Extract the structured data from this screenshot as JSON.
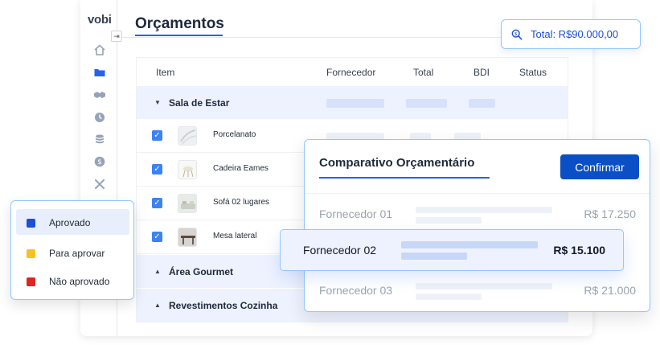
{
  "app": {
    "logo": "vobi"
  },
  "sidebar": {
    "icons": [
      "home-icon",
      "folder-icon",
      "handshake-icon",
      "clock-icon",
      "coins-icon",
      "dollar-icon",
      "tools-icon"
    ]
  },
  "header": {
    "title": "Orçamentos"
  },
  "total": {
    "label": "Total: R$90.000,00",
    "icon": "search-dollar-icon"
  },
  "table": {
    "columns": {
      "item": "Item",
      "supplier": "Fornecedor",
      "total": "Total",
      "bdi": "BDI",
      "status": "Status"
    },
    "groups": [
      {
        "label": "Sala de Estar",
        "expanded": true
      },
      {
        "label": "Área Gourmet",
        "expanded": false
      },
      {
        "label": "Revestimentos Cozinha",
        "expanded": false
      }
    ],
    "items": [
      {
        "name": "Porcelanato",
        "checked": true,
        "thumb": "tile-icon"
      },
      {
        "name": "Cadeira Eames",
        "checked": true,
        "thumb": "chair-icon"
      },
      {
        "name": "Sofá 02 lugares",
        "checked": true,
        "thumb": "sofa-icon"
      },
      {
        "name": "Mesa lateral",
        "checked": true,
        "thumb": "table-icon"
      }
    ]
  },
  "legend": {
    "items": [
      {
        "label": "Aprovado",
        "color": "#1d4ed8",
        "active": true
      },
      {
        "label": "Para aprovar",
        "color": "#fbbf24",
        "active": false
      },
      {
        "label": "Não aprovado",
        "color": "#dc2626",
        "active": false
      }
    ]
  },
  "compare": {
    "title": "Comparativo Orçamentário",
    "confirm_label": "Confirmar",
    "suppliers": [
      {
        "name": "Fornecedor 01",
        "price": "R$ 17.250"
      },
      {
        "name": "Fornecedor 02",
        "price": "R$ 15.100",
        "selected": true
      },
      {
        "name": "Fornecedor 03",
        "price": "R$ 21.000"
      }
    ]
  },
  "colors": {
    "accent": "#2563eb",
    "button": "#0b4fc7",
    "row_highlight": "#eef2fe"
  }
}
